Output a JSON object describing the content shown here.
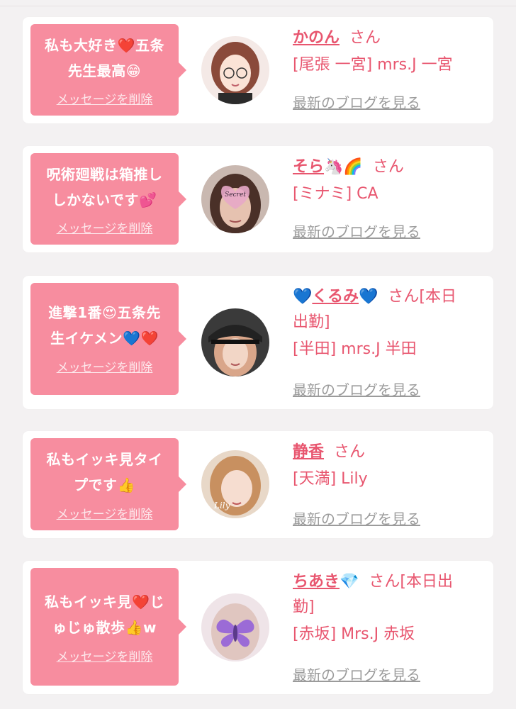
{
  "delete_label": "メッセージを削除",
  "blog_label": "最新のブログを見る",
  "san_label": "さん",
  "cards": [
    {
      "message_lines": [
        "私も大好き❤️五条",
        "先生最高😁"
      ],
      "name": "かのん",
      "name_emoji": "",
      "suffix": "さん",
      "shop_lines": [
        "[尾張 一宮] mrs.J 一宮"
      ],
      "avatar": "illustrated-girl-glasses"
    },
    {
      "message_lines": [
        "呪術廻戦は箱推し",
        "しかないです💕"
      ],
      "name": "そら",
      "name_emoji": "🦄🌈",
      "suffix": "さん",
      "shop_lines": [
        "[ミナミ] CA"
      ],
      "avatar": "secret-heart-photo"
    },
    {
      "message_lines": [
        "進撃1番😍五条先",
        "生イケメン💙❤️"
      ],
      "name": "くるみ",
      "name_emoji_before": "💙",
      "name_emoji": "💙",
      "suffix": "さん[本日",
      "suffix_line2": "出勤]",
      "shop_lines": [
        "[半田] mrs.J 半田"
      ],
      "avatar": "cap-photo"
    },
    {
      "message_lines": [
        "私もイッキ見タイ",
        "プです👍"
      ],
      "name": "静香",
      "name_emoji": "",
      "suffix": "さん",
      "shop_lines": [
        "[天満] Lily"
      ],
      "avatar": "lily-photo"
    },
    {
      "message_lines": [
        "私もイッキ見❤️じ",
        "ゅじゅ散歩👍w"
      ],
      "name": "ちあき",
      "name_emoji": "💎",
      "suffix": "さん[本日出",
      "suffix_line2": "勤]",
      "shop_lines": [
        "[赤坂] Mrs.J 赤坂"
      ],
      "avatar": "butterfly-photo"
    }
  ],
  "colors": {
    "accent_pink": "#e8566f",
    "bubble_pink": "#f78d9f",
    "link_gray": "#9b9b9b",
    "background": "#f3f1f2"
  }
}
